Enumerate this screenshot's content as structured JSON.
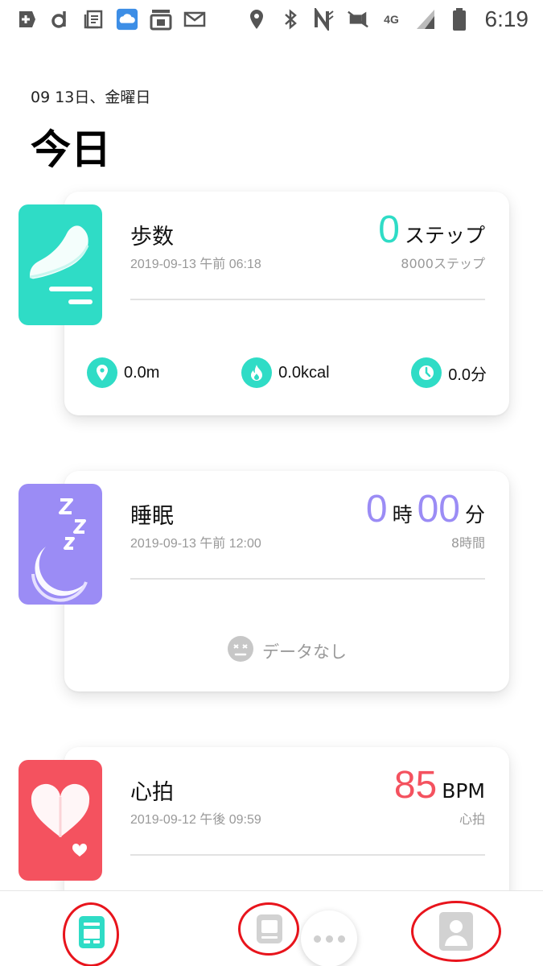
{
  "status_bar": {
    "time": "6:19",
    "network": "4G",
    "icons": [
      "plus-box-icon",
      "d-app-icon",
      "news-icon",
      "cloud-app-icon",
      "uq-mobile-icon",
      "mail-icon",
      "location-icon",
      "bluetooth-icon",
      "nfc-icon",
      "mute-icon",
      "network-4g-icon",
      "signal-icon",
      "battery-icon"
    ]
  },
  "header": {
    "date": "09 13日、金曜日",
    "title": "今日"
  },
  "steps_card": {
    "title": "歩数",
    "timestamp": "2019-09-13 午前 06:18",
    "value": "0",
    "unit": "ステップ",
    "goal": "8000ステップ",
    "accent": "#2fdcc6",
    "stats": [
      {
        "icon": "location-pin-icon",
        "value": "0.0m"
      },
      {
        "icon": "flame-icon",
        "value": "0.0kcal"
      },
      {
        "icon": "clock-icon",
        "value": "0.0分"
      }
    ]
  },
  "sleep_card": {
    "title": "睡眠",
    "timestamp": "2019-09-13 午前 12:00",
    "hours": "0",
    "hours_unit": "時",
    "minutes": "00",
    "minutes_unit": "分",
    "goal": "8時間",
    "no_data": "データなし",
    "accent": "#9b8cf5"
  },
  "heart_card": {
    "title": "心拍",
    "timestamp": "2019-09-12 午後 09:59",
    "value": "85",
    "unit": "BPM",
    "sub": "心拍",
    "accent": "#f4525f"
  },
  "bottom_nav": {
    "items": [
      {
        "name": "today",
        "icon": "dashboard-icon",
        "active": true
      },
      {
        "name": "device",
        "icon": "device-icon",
        "active": false
      },
      {
        "name": "profile",
        "icon": "profile-icon",
        "active": false
      }
    ],
    "active_color": "#2fdcc6",
    "inactive_color": "#c8c8c8",
    "annotation_color": "#e8141c"
  }
}
